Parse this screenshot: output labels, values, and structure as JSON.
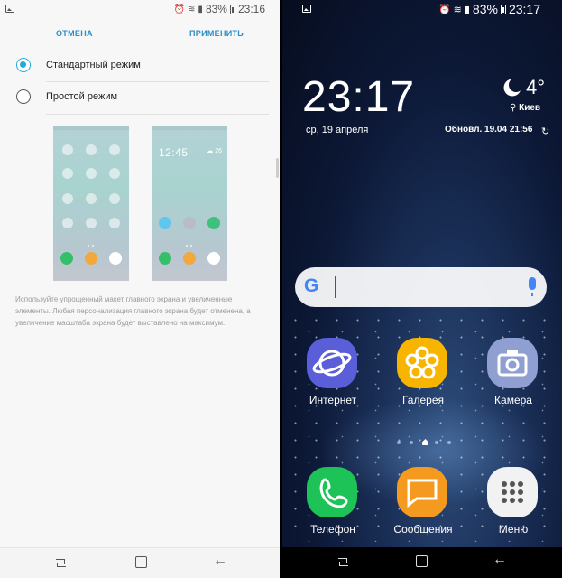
{
  "left_screen": {
    "status": {
      "battery": "83%",
      "time": "23:16"
    },
    "actions": {
      "cancel": "ОТМЕНА",
      "apply": "ПРИМЕНИТЬ"
    },
    "options": [
      {
        "label": "Стандартный режим",
        "selected": true
      },
      {
        "label": "Простой режим",
        "selected": false
      }
    ],
    "preview_easy": {
      "time": "12:45",
      "weather": "☁ 26"
    },
    "description": "Используйте упрощенный макет главного экрана и увеличенные элементы. Любая персонализация главного экрана будет отменена, а увеличение масштаба экрана будет выставлено на максимум."
  },
  "right_screen": {
    "status": {
      "battery": "83%",
      "time": "23:17"
    },
    "clock": "23:17",
    "date": "ср, 19 апреля",
    "weather": {
      "temperature": "4°",
      "city": "Киев",
      "updated": "Обновл. 19.04 21:56"
    },
    "search": {
      "logo": "G"
    },
    "apps": [
      {
        "label": "Интернет",
        "color": "#5a5ed8"
      },
      {
        "label": "Галерея",
        "color": "#f7b500"
      },
      {
        "label": "Камера",
        "color": "#8f9fd1"
      }
    ],
    "dock": [
      {
        "label": "Телефон",
        "color": "#1dc356"
      },
      {
        "label": "Сообщения",
        "color": "#f39a1f"
      },
      {
        "label": "Меню",
        "color": "#f2f2f2"
      }
    ]
  },
  "colors": {
    "accent": "#2a8ec7",
    "radio_on": "#25a8dd"
  }
}
